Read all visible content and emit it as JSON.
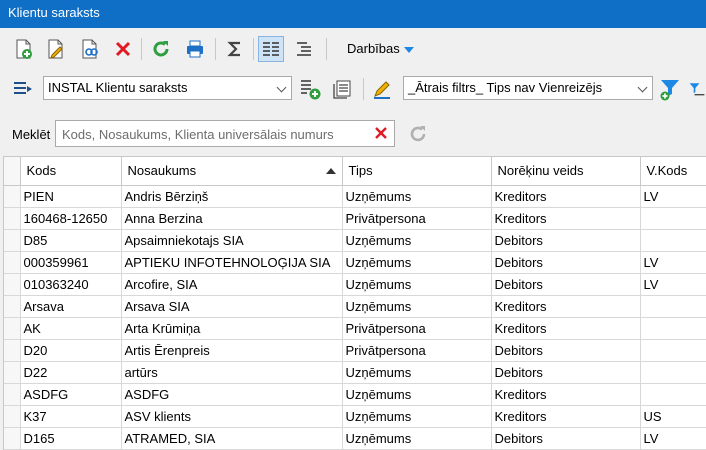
{
  "window": {
    "title": "Klientu saraksts"
  },
  "toolbar": {
    "darbibas_label": "Darbības"
  },
  "list_selector": {
    "value": "INSTAL Klientu saraksts"
  },
  "filter": {
    "value": "_Ātrais filtrs_ Tips nav Vienreizējs"
  },
  "search": {
    "label": "Meklēt",
    "placeholder": "Kods, Nosaukums, Klienta universālais numurs"
  },
  "table": {
    "columns": [
      "Kods",
      "Nosaukums",
      "Tips",
      "Norēķinu veids",
      "V.Kods"
    ],
    "sorted_column": "Nosaukums",
    "sort_direction": "ascending",
    "rows": [
      [
        "PIEN",
        "Andris Bērziņš",
        "Uzņēmums",
        "Kreditors",
        "LV"
      ],
      [
        "160468-12650",
        "Anna Berzina",
        "Privātpersona",
        "Kreditors",
        ""
      ],
      [
        "D85",
        "Apsaimniekotajs SIA",
        "Uzņēmums",
        "Debitors",
        ""
      ],
      [
        "000359961",
        "APTIEKU INFOTEHNOLOĢIJA SIA",
        "Uzņēmums",
        "Debitors",
        "LV"
      ],
      [
        "010363240",
        "Arcofire, SIA",
        "Uzņēmums",
        "Debitors",
        "LV"
      ],
      [
        "Arsava",
        "Arsava SIA",
        "Uzņēmums",
        "Kreditors",
        ""
      ],
      [
        "AK",
        "Arta Krūmiņa",
        "Privātpersona",
        "Kreditors",
        ""
      ],
      [
        "D20",
        "Artis Ērenpreis",
        "Privātpersona",
        "Debitors",
        ""
      ],
      [
        "D22",
        "artūrs",
        "Uzņēmums",
        "Debitors",
        ""
      ],
      [
        "ASDFG",
        "ASDFG",
        "Uzņēmums",
        "Kreditors",
        ""
      ],
      [
        "K37",
        "ASV klients",
        "Uzņēmums",
        "Kreditors",
        "US"
      ],
      [
        "D165",
        "ATRAMED, SIA",
        "Uzņēmums",
        "Debitors",
        "LV"
      ],
      [
        "",
        "",
        "",
        "",
        ""
      ]
    ]
  }
}
